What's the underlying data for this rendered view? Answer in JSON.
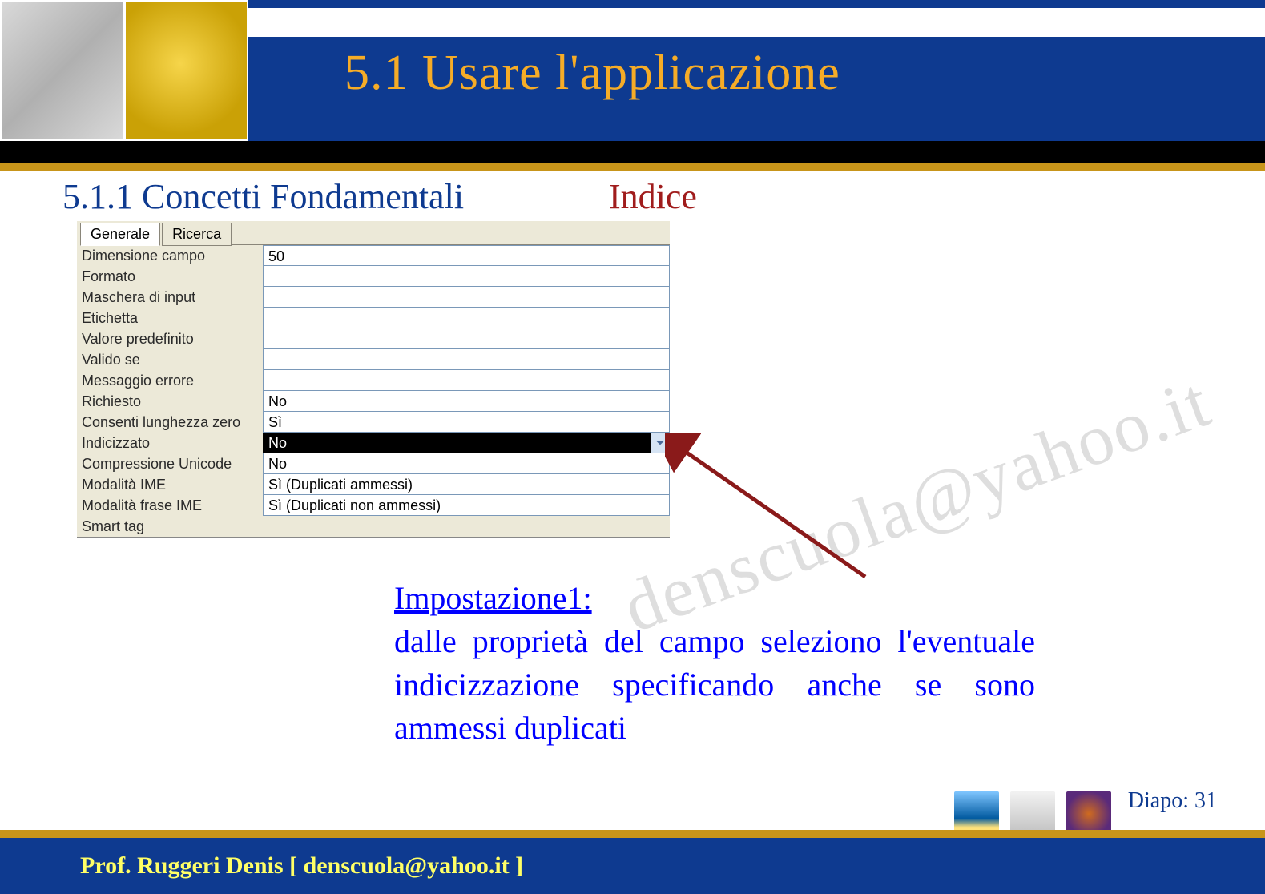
{
  "header": {
    "title": "5.1 Usare l'applicazione"
  },
  "section": {
    "title": "5.1.1 Concetti Fondamentali",
    "index_link": "Indice"
  },
  "pane": {
    "tabs": {
      "active": "Generale",
      "other": "Ricerca"
    },
    "rows": [
      {
        "label": "Dimensione campo",
        "value": "50"
      },
      {
        "label": "Formato",
        "value": ""
      },
      {
        "label": "Maschera di input",
        "value": ""
      },
      {
        "label": "Etichetta",
        "value": ""
      },
      {
        "label": "Valore predefinito",
        "value": ""
      },
      {
        "label": "Valido se",
        "value": ""
      },
      {
        "label": "Messaggio errore",
        "value": ""
      },
      {
        "label": "Richiesto",
        "value": "No"
      },
      {
        "label": "Consenti lunghezza zero",
        "value": "Sì"
      },
      {
        "label": "Indicizzato",
        "value": "No",
        "selected": true,
        "dropdown": true,
        "options": [
          "No",
          "Sì (Duplicati ammessi)",
          "Sì (Duplicati non ammessi)"
        ]
      },
      {
        "label": "Compressione Unicode",
        "value": "No",
        "covered": true
      },
      {
        "label": "Modalità IME",
        "value": "Sì (Duplicati ammessi)",
        "covered": true
      },
      {
        "label": "Modalità frase IME",
        "value": "Sì (Duplicati non ammessi)",
        "covered": true
      },
      {
        "label": "Smart tag",
        "value": "",
        "no_input": true
      }
    ]
  },
  "explain": {
    "heading": "Impostazione1:",
    "body": "dalle proprietà del campo seleziono l'eventuale indicizzazione specificando anche se sono ammessi duplicati"
  },
  "watermark": "denscuola@yahoo.it",
  "footer": {
    "diapo_label": "Diapo:",
    "diapo_num": "31",
    "author": "Prof. Ruggeri Denis  [ denscuola@yahoo.it ]"
  }
}
